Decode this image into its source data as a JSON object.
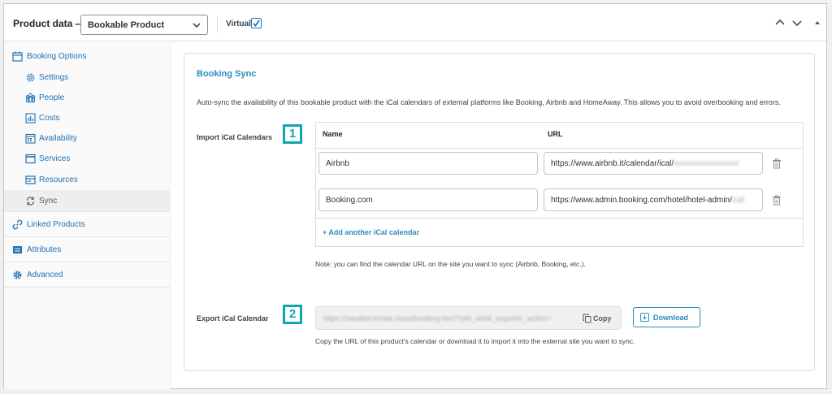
{
  "header": {
    "title": "Product data —",
    "product_type": "Bookable Product",
    "virtual_label": "Virtual:",
    "virtual_checked": true
  },
  "sidebar": {
    "items": [
      {
        "label": "Booking Options",
        "icon": "calendar-icon"
      },
      {
        "label": "Settings",
        "icon": "gear-icon"
      },
      {
        "label": "People",
        "icon": "people-icon"
      },
      {
        "label": "Costs",
        "icon": "chart-icon"
      },
      {
        "label": "Availability",
        "icon": "calendar-grid-icon"
      },
      {
        "label": "Services",
        "icon": "window-icon"
      },
      {
        "label": "Resources",
        "icon": "card-icon"
      },
      {
        "label": "Sync",
        "icon": "sync-icon"
      },
      {
        "label": "Linked Products",
        "icon": "link-icon"
      },
      {
        "label": "Attributes",
        "icon": "list-icon"
      },
      {
        "label": "Advanced",
        "icon": "gear-icon"
      }
    ]
  },
  "sync": {
    "title": "Booking Sync",
    "description": "Auto-sync the availability of this bookable product with the iCal calendars of external platforms like Booking, Airbnb and HomeAway. This allows you to avoid overbooking and errors.",
    "import": {
      "label": "Import iCal Calendars",
      "badge": "1",
      "columns": [
        "Name",
        "URL"
      ],
      "rows": [
        {
          "name": "Airbnb",
          "url": "https://www.airbnb.it/calendar/ical/",
          "url_blur": "xxxxxxxxxxxxxxxx"
        },
        {
          "name": "Booking.com",
          "url": "https://www.admin.booking.com/hotel/hotel-admin/",
          "url_blur": "ical"
        }
      ],
      "add_label": "+ Add another iCal calendar",
      "note": "Note: you can find the calendar URL on the site you want to sync (Airbnb, Booking, etc.)."
    },
    "export": {
      "label": "Export iCal Calendar",
      "badge": "2",
      "url": "https://saraited.kinsta.cloud/booking-doc/?yith_wcbk_exporter_action=",
      "copy_label": "Copy",
      "download_label": "Download",
      "note": "Copy the URL of this product's calendar or download it to import it into the external site you want to sync."
    }
  },
  "colors": {
    "accent": "#2b8bbd",
    "badge": "#11a4b3",
    "link": "#2271b1"
  }
}
